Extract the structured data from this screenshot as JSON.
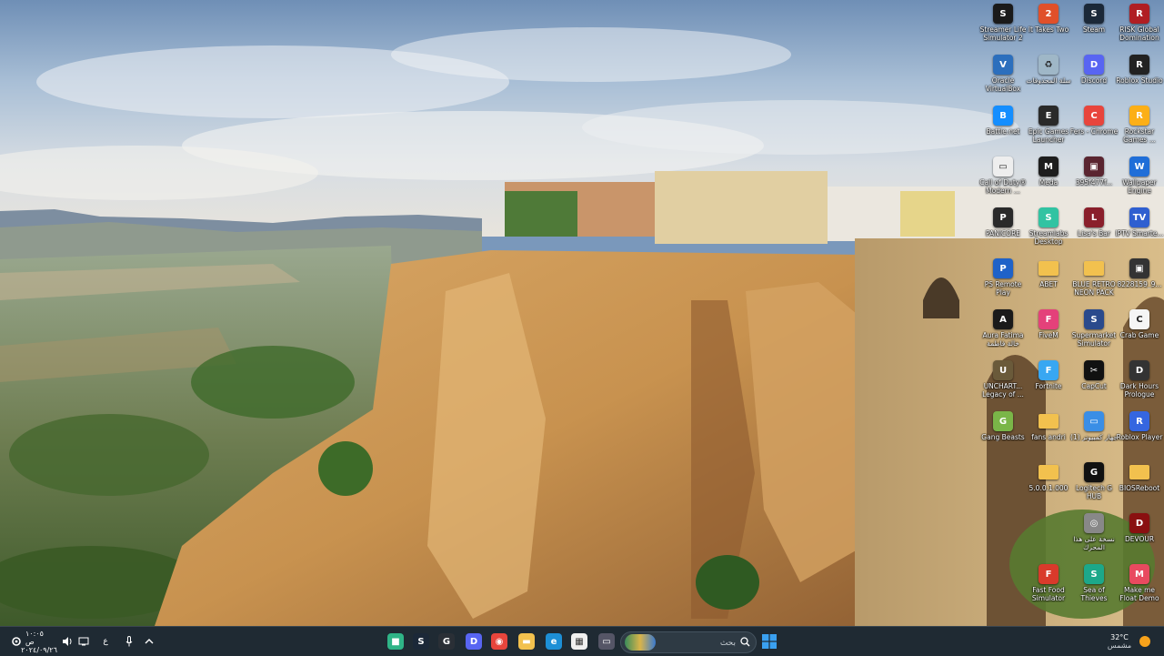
{
  "desktop": {
    "icons": [
      {
        "label": "Streamer Life Simulator 2",
        "color": "#1a1a1a",
        "glyph": "S"
      },
      {
        "label": "It Takes Two",
        "color": "#e0502a",
        "glyph": "2"
      },
      {
        "label": "Steam",
        "color": "#1b2838",
        "glyph": "S"
      },
      {
        "label": "RISK Global Domination",
        "color": "#b01e23",
        "glyph": "R"
      },
      {
        "label": "Oracle VirtualBox",
        "color": "#2c6fbd",
        "glyph": "V"
      },
      {
        "label": "سلة المحذوفات",
        "color": "#9fb7c7",
        "glyph": "♻"
      },
      {
        "label": "Discord",
        "color": "#5865f2",
        "glyph": "D"
      },
      {
        "label": "Roblox Studio",
        "color": "#222",
        "glyph": "R"
      },
      {
        "label": "Battle.net",
        "color": "#148eff",
        "glyph": "B"
      },
      {
        "label": "Epic Games Launcher",
        "color": "#2a2a2a",
        "glyph": "E"
      },
      {
        "label": "Fers - Chrome",
        "color": "#e8453c",
        "glyph": "C"
      },
      {
        "label": "Rockstar Games ...",
        "color": "#fcaf17",
        "glyph": "R"
      },
      {
        "label": "Call of Duty® Modern ...",
        "color": "#eeeeee",
        "glyph": "▭"
      },
      {
        "label": "Meda",
        "color": "#1d1d1d",
        "glyph": "M"
      },
      {
        "label": "395f477f...",
        "color": "#5a2530",
        "glyph": "▣"
      },
      {
        "label": "Wallpaper Engine",
        "color": "#1f6ed8",
        "glyph": "W"
      },
      {
        "label": "PANICORE",
        "color": "#2a2a2a",
        "glyph": "P"
      },
      {
        "label": "Streamlabs Desktop",
        "color": "#31c3a2",
        "glyph": "S"
      },
      {
        "label": "Lisa's Bar",
        "color": "#8a1f2b",
        "glyph": "L"
      },
      {
        "label": "IPTV Smarte...",
        "color": "#2f5fd0",
        "glyph": "TV"
      },
      {
        "label": "PS Remote Play",
        "color": "#1f62c8",
        "glyph": "P"
      },
      {
        "label": "ABET",
        "color": "#f2c14e",
        "glyph": ""
      },
      {
        "label": "BLUE RETRO NEON PACK",
        "color": "#f2c14e",
        "glyph": ""
      },
      {
        "label": "8228159_9...",
        "color": "#333",
        "glyph": "▣"
      },
      {
        "label": "Aura Fatima خالة فاطمة",
        "color": "#1a1a1a",
        "glyph": "A"
      },
      {
        "label": "FiveM",
        "color": "#e4417a",
        "glyph": "F"
      },
      {
        "label": "Supermarket Simulator",
        "color": "#2a4a8c",
        "glyph": "S"
      },
      {
        "label": "Crab Game",
        "color": "#f5f5f5",
        "glyph": "C"
      },
      {
        "label": "UNCHART... Legacy of ...",
        "color": "#6a5a3a",
        "glyph": "U"
      },
      {
        "label": "Fortnite",
        "color": "#38a7f2",
        "glyph": "F"
      },
      {
        "label": "CapCut",
        "color": "#111",
        "glyph": "✂"
      },
      {
        "label": "Dark Hours Prologue",
        "color": "#333",
        "glyph": "D"
      },
      {
        "label": "Gang Beasts",
        "color": "#7ab648",
        "glyph": "G"
      },
      {
        "label": "fans andri",
        "color": "#f2c14e",
        "glyph": ""
      },
      {
        "label": "جهاز كمبيوتر (1)",
        "color": "#3a8ee6",
        "glyph": "▭"
      },
      {
        "label": "Roblox Player",
        "color": "#3566e0",
        "glyph": "R"
      },
      {
        "label": "5.0.0.1.000",
        "color": "#f2c14e",
        "glyph": ""
      },
      {
        "label": "Logitech G HUB",
        "color": "#111",
        "glyph": "G"
      },
      {
        "label": "BIOSReboot",
        "color": "#f2c14e",
        "glyph": ""
      },
      {
        "label": "نسخة على هذا المحرك",
        "color": "#888",
        "glyph": "◎"
      },
      {
        "label": "DEVOUR",
        "color": "#8a1010",
        "glyph": "D"
      },
      {
        "label": "Fast Food Simulator",
        "color": "#d93a2b",
        "glyph": "F"
      },
      {
        "label": "Sea of Thieves",
        "color": "#1ca88a",
        "glyph": "S"
      },
      {
        "label": "Make me Float Demo",
        "color": "#e84a5f",
        "glyph": "M"
      }
    ]
  },
  "taskbar": {
    "search_placeholder": "بحث",
    "weather_temp": "32°C",
    "weather_text": "مشمس",
    "clock_time": "١٠:٠٥ ص",
    "clock_date": "٢٠٢٤/٠٩/٢٦",
    "language": "ع",
    "pinned": [
      {
        "name": "taskbar-app-1",
        "color": "#2fb487",
        "glyph": "■"
      },
      {
        "name": "taskbar-steam",
        "color": "#1b2838",
        "glyph": "S"
      },
      {
        "name": "taskbar-app-3",
        "color": "#2a2f36",
        "glyph": "G"
      },
      {
        "name": "taskbar-discord",
        "color": "#5865f2",
        "glyph": "D"
      },
      {
        "name": "taskbar-chrome",
        "color": "#e8453c",
        "glyph": "◉"
      },
      {
        "name": "taskbar-file-explorer",
        "color": "#f2c14e",
        "glyph": "▬"
      },
      {
        "name": "taskbar-edge",
        "color": "#1d8fd6",
        "glyph": "e"
      },
      {
        "name": "taskbar-store",
        "color": "#f0f0f0",
        "glyph": "▦"
      },
      {
        "name": "taskbar-task-view",
        "color": "#556",
        "glyph": "▭"
      }
    ]
  }
}
